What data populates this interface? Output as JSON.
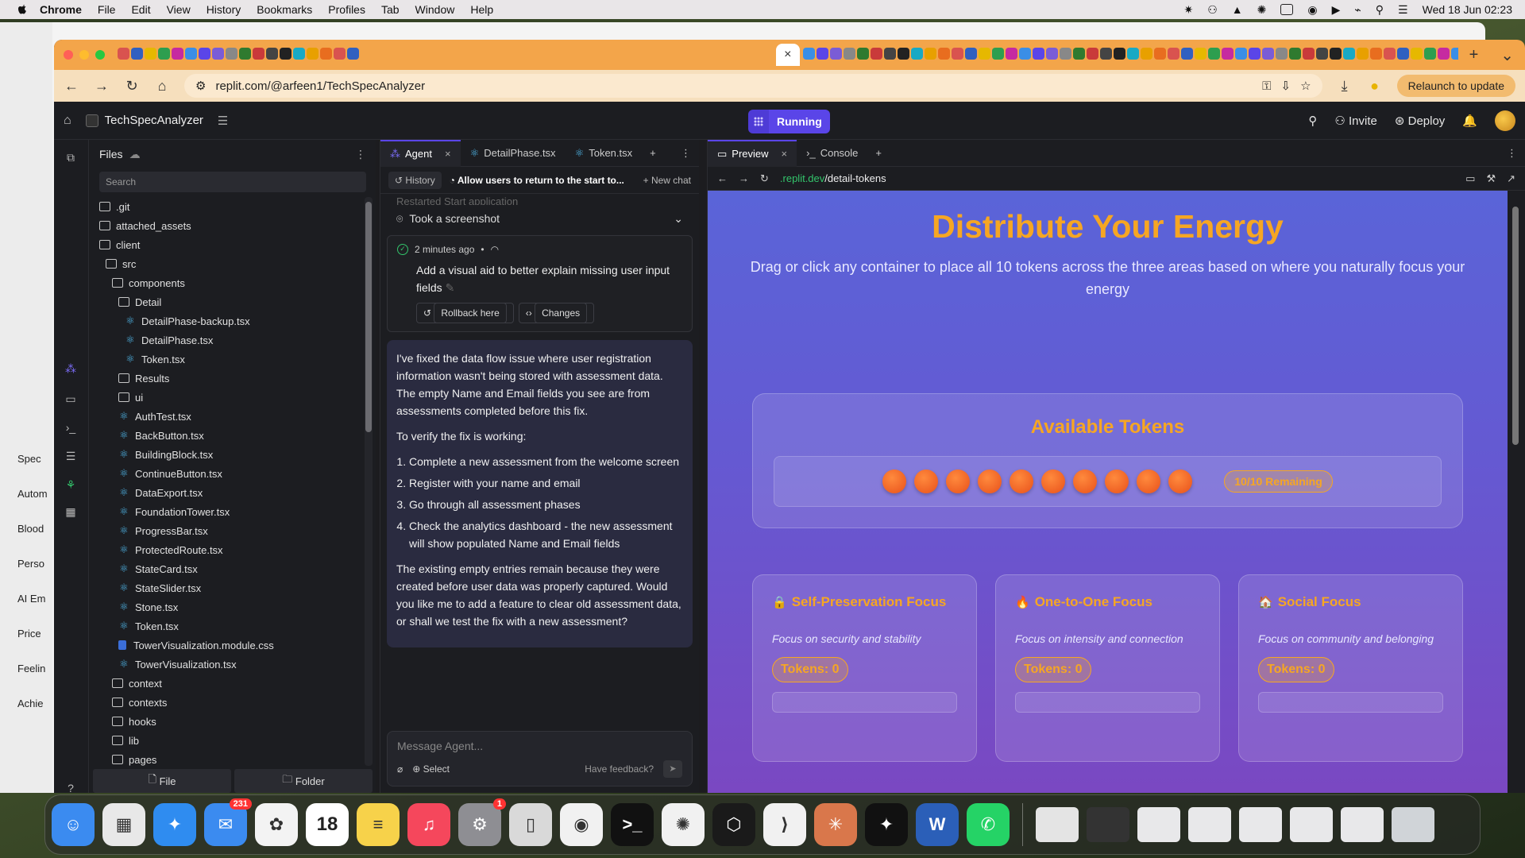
{
  "menubar": {
    "items": [
      "Chrome",
      "File",
      "Edit",
      "View",
      "History",
      "Bookmarks",
      "Profiles",
      "Tab",
      "Window",
      "Help"
    ],
    "clock": "Wed 18 Jun  02:23"
  },
  "back_window": {
    "sidebar_items": [
      "Spec",
      "Autom",
      "Blood",
      "Perso",
      "AI Em",
      "Price",
      "Feelin",
      "Achie"
    ]
  },
  "chrome": {
    "url": "replit.com/@arfeen1/TechSpecAnalyzer",
    "relaunch_label": "Relaunch to update",
    "favicon_colors": [
      "#d9534f",
      "#7a5cd6",
      "#e8a000",
      "#3a8ee6",
      "#222222",
      "#2d9e4f",
      "#c93a3a",
      "#3060c0",
      "#888888",
      "#e86d1f",
      "#5a45e8",
      "#19a9c4",
      "#c62aa0",
      "#444444",
      "#e6b800",
      "#2f7a2f"
    ]
  },
  "replit": {
    "project_name": "TechSpecAnalyzer",
    "running_label": "Running",
    "invite_label": "Invite",
    "deploy_label": "Deploy"
  },
  "files": {
    "title": "Files",
    "search_placeholder": "Search",
    "tree": [
      {
        "name": ".git",
        "type": "folder",
        "indent": 0
      },
      {
        "name": "attached_assets",
        "type": "folder",
        "indent": 0
      },
      {
        "name": "client",
        "type": "folder",
        "indent": 0
      },
      {
        "name": "src",
        "type": "folder",
        "indent": 1
      },
      {
        "name": "components",
        "type": "folder",
        "indent": 2
      },
      {
        "name": "Detail",
        "type": "folder",
        "indent": 3
      },
      {
        "name": "DetailPhase-backup.tsx",
        "type": "react",
        "indent": 4
      },
      {
        "name": "DetailPhase.tsx",
        "type": "react",
        "indent": 4
      },
      {
        "name": "Token.tsx",
        "type": "react",
        "indent": 4
      },
      {
        "name": "Results",
        "type": "folder",
        "indent": 3
      },
      {
        "name": "ui",
        "type": "folder",
        "indent": 3
      },
      {
        "name": "AuthTest.tsx",
        "type": "react",
        "indent": 3
      },
      {
        "name": "BackButton.tsx",
        "type": "react",
        "indent": 3
      },
      {
        "name": "BuildingBlock.tsx",
        "type": "react",
        "indent": 3
      },
      {
        "name": "ContinueButton.tsx",
        "type": "react",
        "indent": 3
      },
      {
        "name": "DataExport.tsx",
        "type": "react",
        "indent": 3
      },
      {
        "name": "FoundationTower.tsx",
        "type": "react",
        "indent": 3
      },
      {
        "name": "ProgressBar.tsx",
        "type": "react",
        "indent": 3
      },
      {
        "name": "ProtectedRoute.tsx",
        "type": "react",
        "indent": 3
      },
      {
        "name": "StateCard.tsx",
        "type": "react",
        "indent": 3
      },
      {
        "name": "StateSlider.tsx",
        "type": "react",
        "indent": 3
      },
      {
        "name": "Stone.tsx",
        "type": "react",
        "indent": 3
      },
      {
        "name": "Token.tsx",
        "type": "react",
        "indent": 3
      },
      {
        "name": "TowerVisualization.module.css",
        "type": "css",
        "indent": 3
      },
      {
        "name": "TowerVisualization.tsx",
        "type": "react",
        "indent": 3
      },
      {
        "name": "context",
        "type": "folder",
        "indent": 2
      },
      {
        "name": "contexts",
        "type": "folder",
        "indent": 2
      },
      {
        "name": "hooks",
        "type": "folder",
        "indent": 2
      },
      {
        "name": "lib",
        "type": "folder",
        "indent": 2
      },
      {
        "name": "pages",
        "type": "folder",
        "indent": 2
      }
    ],
    "footer_file": "File",
    "footer_folder": "Folder"
  },
  "agent": {
    "tabs": [
      {
        "label": "Agent",
        "active": true,
        "closable": true
      },
      {
        "label": "DetailPhase.tsx",
        "active": false,
        "closable": false
      },
      {
        "label": "Token.tsx",
        "active": false,
        "closable": false
      }
    ],
    "history_label": "History",
    "thread_title": "Allow users to return to the start to...",
    "new_chat_label": "New chat",
    "faded_line": "Restarted Start application",
    "screenshot_label": "Took a screenshot",
    "checkpoint": {
      "time": "2 minutes ago",
      "description": "Add a visual aid to better explain missing user input fields",
      "rollback_label": "Rollback here",
      "changes_label": "Changes"
    },
    "message": {
      "p1": "I've fixed the data flow issue where user registration information wasn't being stored with assessment data. The empty Name and Email fields you see are from assessments completed before this fix.",
      "p2": "To verify the fix is working:",
      "steps": [
        "Complete a new assessment from the welcome screen",
        "Register with your name and email",
        "Go through all assessment phases",
        "Check the analytics dashboard - the new assessment will show populated Name and Email fields"
      ],
      "p3": "The existing empty entries remain because they were created before user data was properly captured. Would you like me to add a feature to clear old assessment data, or shall we test the fix with a new assessment?"
    },
    "input_placeholder": "Message Agent...",
    "select_label": "Select",
    "feedback_label": "Have feedback?"
  },
  "preview": {
    "tabs": [
      "Preview",
      "Console"
    ],
    "url_host": ".replit.dev",
    "url_path": "/detail-tokens",
    "title": "Distribute Your Energy",
    "subtitle": "Drag or click any container to place all 10 tokens across the three areas based on where you naturally focus your energy",
    "available_title": "Available Tokens",
    "token_count": 10,
    "remaining_label": "10/10 Remaining",
    "zones": [
      {
        "icon": "🔒",
        "title": "Self-Preservation Focus",
        "desc": "Focus on security and stability",
        "tokens": "Tokens: 0"
      },
      {
        "icon": "🔥",
        "title": "One-to-One Focus",
        "desc": "Focus on intensity and connection",
        "tokens": "Tokens: 0"
      },
      {
        "icon": "🏠",
        "title": "Social Focus",
        "desc": "Focus on community and belonging",
        "tokens": "Tokens: 0"
      }
    ]
  },
  "dock": {
    "apps": [
      {
        "name": "finder",
        "color": "#3b8bf0",
        "glyph": "☺"
      },
      {
        "name": "launchpad",
        "color": "#e8e8e8",
        "glyph": "▦"
      },
      {
        "name": "safari",
        "color": "#2f8cf0",
        "glyph": "✦"
      },
      {
        "name": "mail",
        "color": "#3b8bf0",
        "glyph": "✉",
        "badge": "231"
      },
      {
        "name": "photos",
        "color": "#f3f3f3",
        "glyph": "✿"
      },
      {
        "name": "calendar",
        "color": "#ffffff",
        "glyph": "18"
      },
      {
        "name": "notes",
        "color": "#f7d24a",
        "glyph": "≡"
      },
      {
        "name": "music",
        "color": "#f5475c",
        "glyph": "♫"
      },
      {
        "name": "system-settings",
        "color": "#8e8e93",
        "glyph": "⚙",
        "badge": "1"
      },
      {
        "name": "iphone-mirroring",
        "color": "#d9d9d9",
        "glyph": "▯"
      },
      {
        "name": "chrome",
        "color": "#f1f1f1",
        "glyph": "◉"
      },
      {
        "name": "terminal",
        "color": "#111111",
        "glyph": ">_"
      },
      {
        "name": "chatgpt",
        "color": "#f1f1f1",
        "glyph": "✺"
      },
      {
        "name": "cursor",
        "color": "#1a1a1a",
        "glyph": "⬡"
      },
      {
        "name": "vscode",
        "color": "#f1f1f1",
        "glyph": "⟩"
      },
      {
        "name": "claude",
        "color": "#d9774b",
        "glyph": "✳"
      },
      {
        "name": "perplexity",
        "color": "#111111",
        "glyph": "✦"
      },
      {
        "name": "word",
        "color": "#2b5fb8",
        "glyph": "W"
      },
      {
        "name": "whatsapp",
        "color": "#25d366",
        "glyph": "✆"
      }
    ],
    "recent": [
      {
        "name": "archive",
        "color": "#e4e4e4"
      },
      {
        "name": "window-thumb",
        "color": "#333333"
      },
      {
        "name": "window-thumb",
        "color": "#e8e8ea"
      },
      {
        "name": "window-thumb",
        "color": "#e8e8ea"
      },
      {
        "name": "window-thumb",
        "color": "#e8e8ea"
      },
      {
        "name": "window-thumb",
        "color": "#e8e8ea"
      },
      {
        "name": "window-thumb",
        "color": "#e8e8ea"
      },
      {
        "name": "trash",
        "color": "#d0d4d8"
      }
    ]
  }
}
